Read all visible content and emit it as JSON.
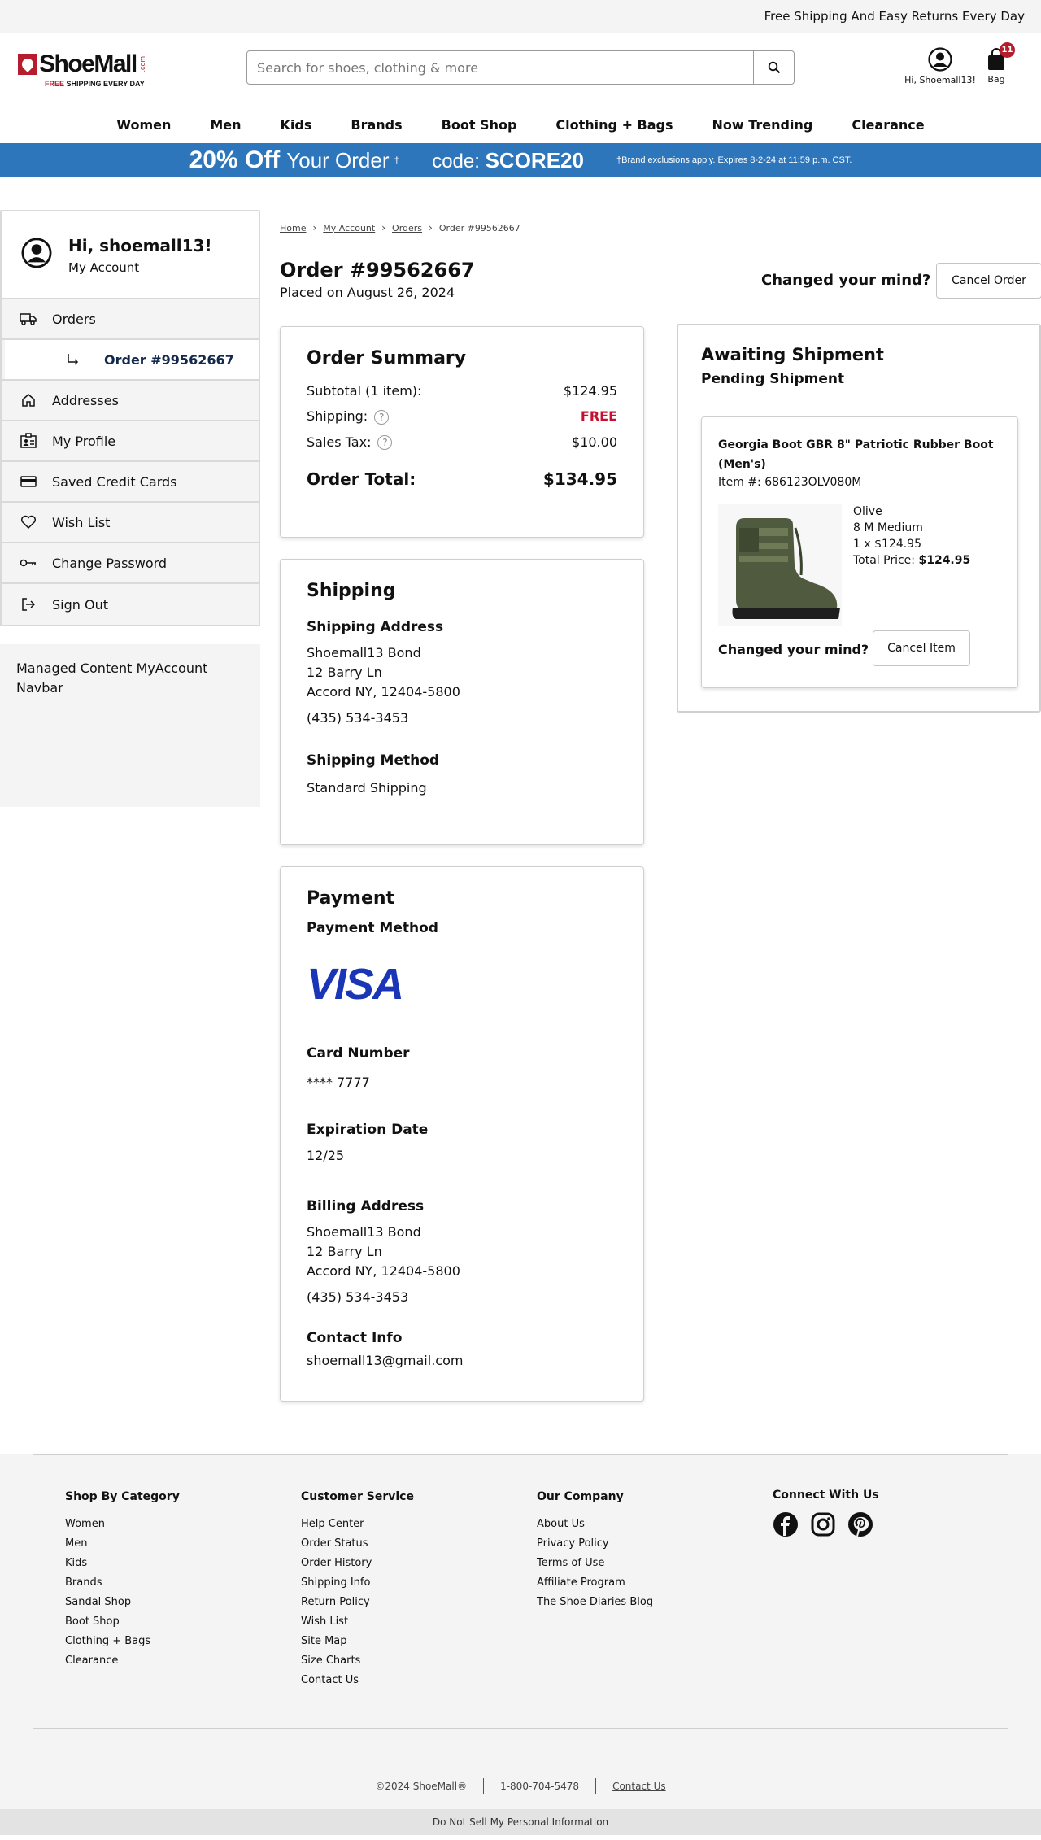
{
  "topbar": {
    "text": "Free Shipping And Easy Returns Every Day"
  },
  "logo": {
    "name": "ShoeMall",
    "dotcom": ".com",
    "tagline_free": "FREE",
    "tagline_rest": "SHIPPING EVERY DAY"
  },
  "search": {
    "placeholder": "Search for shoes, clothing & more",
    "value": ""
  },
  "account": {
    "label": "Hi, Shoemall13!"
  },
  "bag": {
    "label": "Bag",
    "count": "11"
  },
  "nav": [
    "Women",
    "Men",
    "Kids",
    "Brands",
    "Boot Shop",
    "Clothing + Bags",
    "Now Trending",
    "Clearance"
  ],
  "promo": {
    "percent": "20% Off",
    "your_order": "Your Order",
    "dagger": "†",
    "code_label": "code:",
    "code": "SCORE20",
    "fine": "†Brand exclusions apply. Expires 8-2-24 at 11:59 p.m. CST."
  },
  "sidebar": {
    "greeting": "Hi, shoemall13!",
    "my_account": "My Account",
    "items": [
      {
        "label": "Orders",
        "icon": "truck-icon"
      },
      {
        "label": "Order #99562667",
        "icon": "sub-arrow-icon"
      },
      {
        "label": "Addresses",
        "icon": "home-icon"
      },
      {
        "label": "My Profile",
        "icon": "profile-card-icon"
      },
      {
        "label": "Saved Credit Cards",
        "icon": "credit-card-icon"
      },
      {
        "label": "Wish List",
        "icon": "heart-icon"
      },
      {
        "label": "Change Password",
        "icon": "key-icon"
      },
      {
        "label": "Sign Out",
        "icon": "sign-out-icon"
      }
    ],
    "managed": "Managed Content MyAccount Navbar"
  },
  "breadcrumb": {
    "home": "Home",
    "account": "My Account",
    "orders": "Orders",
    "current": "Order #99562667"
  },
  "order": {
    "title": "Order #99562667",
    "placed": "Placed on August 26, 2024",
    "changed_mind": "Changed your mind?",
    "cancel_order": "Cancel Order"
  },
  "summary": {
    "title": "Order Summary",
    "subtotal_label": "Subtotal (1 item):",
    "subtotal": "$124.95",
    "shipping_label": "Shipping:",
    "shipping": "FREE",
    "tax_label": "Sales Tax:",
    "tax": "$10.00",
    "total_label": "Order Total:",
    "total": "$134.95"
  },
  "shipping": {
    "title": "Shipping",
    "address_heading": "Shipping Address",
    "name": "Shoemall13 Bond",
    "street": "12 Barry Ln",
    "city": "Accord NY, 12404-5800",
    "phone": "(435) 534-3453",
    "method_heading": "Shipping Method",
    "method": "Standard Shipping"
  },
  "payment": {
    "title": "Payment",
    "method_heading": "Payment Method",
    "brand": "VISA",
    "card_heading": "Card Number",
    "card": "**** 7777",
    "exp_heading": "Expiration Date",
    "exp": "12/25",
    "billing_heading": "Billing Address",
    "name": "Shoemall13 Bond",
    "street": "12 Barry Ln",
    "city": "Accord NY, 12404-5800",
    "phone": "(435) 534-3453",
    "contact_heading": "Contact Info",
    "email": "shoemall13@gmail.com"
  },
  "status": {
    "title": "Awaiting Shipment",
    "subtitle": "Pending Shipment",
    "item": {
      "name": "Georgia Boot GBR 8\" Patriotic Rubber Boot (Men's)",
      "number": "Item #: 686123OLV080M",
      "color": "Olive",
      "size": "8 M Medium",
      "qty_price": "1 x $124.95",
      "total_label": "Total Price:",
      "total": "$124.95",
      "changed_mind": "Changed your mind?",
      "cancel": "Cancel Item"
    }
  },
  "footer": {
    "categories": {
      "title": "Shop By Category",
      "links": [
        "Women",
        "Men",
        "Kids",
        "Brands",
        "Sandal Shop",
        "Boot Shop",
        "Clothing + Bags",
        "Clearance"
      ]
    },
    "service": {
      "title": "Customer Service",
      "links": [
        "Help Center",
        "Order Status",
        "Order History",
        "Shipping Info",
        "Return Policy",
        "Wish List",
        "Site Map",
        "Size Charts",
        "Contact Us"
      ]
    },
    "company": {
      "title": "Our Company",
      "links": [
        "About Us",
        "Privacy Policy",
        "Terms of Use",
        "Affiliate Program",
        "The Shoe Diaries Blog"
      ]
    },
    "connect": {
      "title": "Connect With Us"
    },
    "copyright": "©2024 ShoeMall®",
    "phone": "1-800-704-5478",
    "contact": "Contact Us",
    "dnsl": "Do Not Sell My Personal Information"
  },
  "colors": {
    "promo": "#2d76bb",
    "brand_red": "#b51c2e",
    "free": "#c8102e",
    "visa": "#1a36b6"
  }
}
